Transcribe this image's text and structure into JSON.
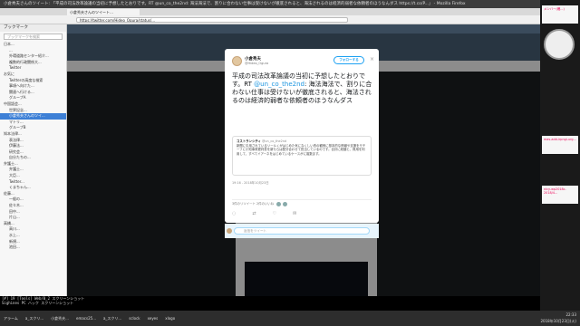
{
  "window": {
    "title": "小倉秀夫さんのツイート: 「平成の司法改革論議の当初に予想したとおりです。RT @un_co_the2nd: 海法海法で、割りに合わない仕事は受けないが徹底されると、海法されるのは経済的弱者な依頼者のほうなんダス https://t.co/P...」 - Mozilla Firefox"
  },
  "tab": {
    "label": "小倉秀夫さんのツイート…"
  },
  "url": {
    "value": "https://twitter.com/Hideo_Ogura/status/..."
  },
  "sidebar": {
    "title": "ブックマーク",
    "search_placeholder": "ブックマークを検索",
    "items": [
      {
        "label": "日本..."
      },
      {
        "label": "..."
      },
      {
        "label": "外環道路センター紹介..."
      },
      {
        "label": "複数的行政関係大..."
      },
      {
        "label": "Twitter"
      },
      {
        "label": "お気に"
      },
      {
        "label": "Twitterの高度な検索"
      },
      {
        "label": "事項へ向けた..."
      },
      {
        "label": "関連へ行ける..."
      },
      {
        "label": "グループA"
      },
      {
        "label": "中国語会..."
      },
      {
        "label": "世界記念..."
      },
      {
        "label": "小倉秀夫さんのツイ...",
        "selected": true
      },
      {
        "label": "マトリ..."
      },
      {
        "label": "グループB"
      },
      {
        "label": "知本法律..."
      },
      {
        "label": "表法律..."
      },
      {
        "label": "伊藤法..."
      },
      {
        "label": "研究会..."
      },
      {
        "label": "自分たちの..."
      },
      {
        "label": "弁護士..."
      },
      {
        "label": "弁護士..."
      },
      {
        "label": "大臣..."
      },
      {
        "label": "Twitter..."
      },
      {
        "label": "くまちゃん..."
      },
      {
        "label": "佐藤..."
      },
      {
        "label": "一般の..."
      },
      {
        "label": "佐々木..."
      },
      {
        "label": "田中..."
      },
      {
        "label": "片山..."
      },
      {
        "label": "高橋..."
      },
      {
        "label": "高川..."
      },
      {
        "label": "水上..."
      },
      {
        "label": "新規..."
      },
      {
        "label": "池田..."
      }
    ]
  },
  "modal": {
    "display_name": "小倉秀夫",
    "handle": "@Hideo_Ogura",
    "follow_label": "フォローする",
    "close_label": "×",
    "tweet_text_before": "平成の司法改革論議の当初に予想したとおりです。RT ",
    "tweet_mention": "@un_co_the2nd",
    "tweet_text_after": ": 海法海法で、割りに合わない仕事は受けないが徹底されると、海法されるのは経済的弱者な依頼者のほうなんダス",
    "quote_author": "コストランシティ",
    "quote_handle": "@un_co_the2nd",
    "quote_text": "新聞に引用されているリールくがはじめた気になくしい低の観例に基本的な情報や支援をモチーフに小知事費更判書を新たらは配分合わせて担当しているのです。合計に総額と、費用を利用して、すべてイアーネをはじめているケースがに複数ます。",
    "time": "19:16 - 2018年10月23日",
    "stats": "3件のリツイート  2件のいいね",
    "reply_placeholder": "返信をツイート"
  },
  "timeline": {
    "author": "小倉秀夫",
    "text": "藤井くん(中国語には、..."
  },
  "console": {
    "line1": "[#] 19  [Tools] Web/0_2 スクリーンショット",
    "line2": "Sighines PC  ハック スクリーンショット"
  },
  "taskbar": {
    "items": [
      "アラーム",
      "a_スクリ...",
      "小倉秀夫...",
      "emacs25...",
      "a_スクリ...",
      "sclock",
      "xeyes",
      "xlogo"
    ],
    "time": "22:33",
    "date": "2018年10月23日(火)"
  },
  "desktop": {
    "sticky1": "メンバー(確...)",
    "sticky2": "mas-add-irpngi-urg...",
    "sticky3": "nicy-wp2018c-2018/4..."
  },
  "colors": {
    "twitter_blue": "#1da1f2",
    "mention_blue": "#1b95e0",
    "selection_blue": "#3d80d6"
  }
}
